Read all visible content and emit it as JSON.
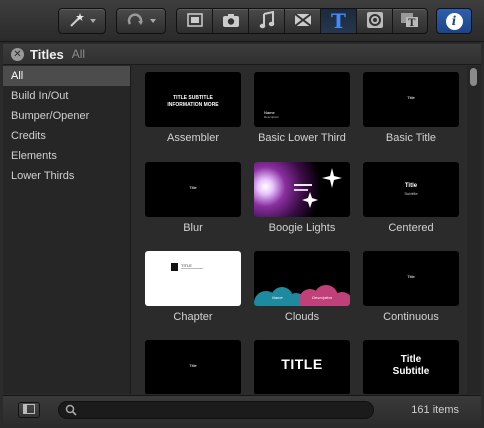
{
  "toolbar": {
    "buttons": [
      {
        "name": "magic-wand",
        "icon": "magic-wand-icon"
      },
      {
        "name": "undo",
        "icon": "undo-arrow-icon"
      },
      {
        "name": "photos",
        "icon": "film-strip-icon"
      },
      {
        "name": "camera",
        "icon": "camera-icon"
      },
      {
        "name": "music",
        "icon": "music-note-icon"
      },
      {
        "name": "transitions",
        "icon": "transitions-icon"
      },
      {
        "name": "titles",
        "icon": "titles-T-icon",
        "active": true
      },
      {
        "name": "generators",
        "icon": "generators-icon"
      },
      {
        "name": "themes",
        "icon": "themes-icon"
      },
      {
        "name": "info",
        "icon": "info-icon"
      }
    ],
    "accent_color": "#2e5fae"
  },
  "header": {
    "title": "Titles",
    "breadcrumb": "All"
  },
  "sidebar": {
    "items": [
      {
        "label": "All",
        "selected": true
      },
      {
        "label": "Build In/Out"
      },
      {
        "label": "Bumper/Opener"
      },
      {
        "label": "Credits"
      },
      {
        "label": "Elements"
      },
      {
        "label": "Lower Thirds"
      }
    ]
  },
  "grid": {
    "tiles": [
      {
        "label": "Assembler",
        "thumb_lines": [
          "TITLE SUBTITLE",
          "INFORMATION MORE"
        ]
      },
      {
        "label": "Basic Lower Third",
        "thumb_lines": [
          "Name",
          "Description"
        ]
      },
      {
        "label": "Basic Title",
        "thumb_lines": [
          "Title"
        ]
      },
      {
        "label": "Blur",
        "thumb_lines": [
          "Title"
        ]
      },
      {
        "label": "Boogie Lights",
        "thumb_lines": []
      },
      {
        "label": "Centered",
        "thumb_lines": [
          "Title",
          "Subtitle"
        ]
      },
      {
        "label": "Chapter",
        "thumb_lines": [
          "TITLE"
        ]
      },
      {
        "label": "Clouds",
        "thumb_lines": [
          "Name",
          "Description"
        ]
      },
      {
        "label": "Continuous",
        "thumb_lines": [
          "Title"
        ]
      },
      {
        "label": "",
        "thumb_lines": [
          "Title"
        ]
      },
      {
        "label": "",
        "thumb_lines": [
          "TITLE"
        ]
      },
      {
        "label": "",
        "thumb_lines": [
          "Title",
          "Subtitle"
        ]
      }
    ]
  },
  "footer": {
    "search_value": "",
    "search_placeholder": "",
    "item_count": "161 items"
  }
}
